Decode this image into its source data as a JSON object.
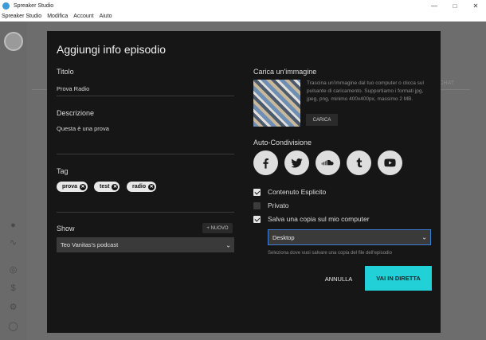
{
  "window": {
    "title": "Spreaker Studio"
  },
  "menu": {
    "items": [
      "Spreaker Studio",
      "Modifica",
      "Account",
      "Aiuto"
    ]
  },
  "modal": {
    "title": "Aggiungi info episodio",
    "titolo_label": "Titolo",
    "titolo_value": "Prova Radio",
    "descrizione_label": "Descrizione",
    "descrizione_value": "Questa è una prova",
    "tag_label": "Tag",
    "tags": [
      "prova",
      "test",
      "radio"
    ],
    "show_label": "Show",
    "nuovo_label": "+ NUOVO",
    "show_value": "Teo Vanitas's podcast",
    "image_label": "Carica un'immagine",
    "image_help": "Trascina un'immagine dal tuo computer o clicca sul pulsante di caricamento. Supportiamo i formati jpg, jpeg, png, minimo 400x400px, massimo 2 MB.",
    "carica_label": "CARICA",
    "share_label": "Auto-Condivisione",
    "social": [
      "facebook",
      "twitter",
      "soundcloud",
      "tumblr",
      "youtube"
    ],
    "checkboxes": [
      {
        "label": "Contenuto Esplicito",
        "checked": true
      },
      {
        "label": "Privato",
        "checked": false
      },
      {
        "label": "Salva una copia sul mio computer",
        "checked": true
      }
    ],
    "destination_value": "Desktop",
    "destination_hint": "Seleziona dove vuoi salvare una copia del file dell'episodio",
    "annulla_label": "ANNULLA",
    "diretta_label": "VAI IN DIRETTA"
  },
  "background": {
    "tab_label": "CHAT"
  },
  "colors": {
    "accent": "#22d0d8",
    "modal_bg": "#161616",
    "focus_border": "#3b7fd6"
  }
}
